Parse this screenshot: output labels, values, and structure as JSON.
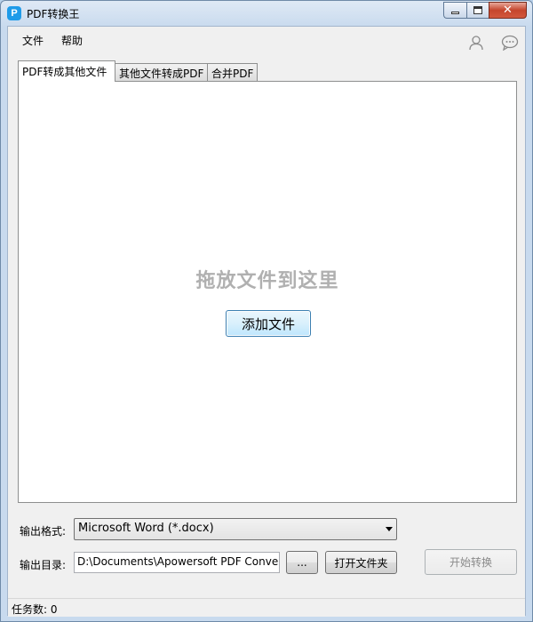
{
  "window": {
    "title": "PDF转换王",
    "icon_letter": "P",
    "close_glyph": "✕"
  },
  "menu": {
    "file": "文件",
    "help": "帮助"
  },
  "tabs": [
    {
      "label": "PDF转成其他文件",
      "active": true
    },
    {
      "label": "其他文件转成PDF",
      "active": false
    },
    {
      "label": "合并PDF",
      "active": false
    }
  ],
  "panel": {
    "drop_hint": "拖放文件到这里",
    "add_file_label": "添加文件"
  },
  "output": {
    "format_label": "输出格式:",
    "format_value": "Microsoft Word (*.docx)",
    "dir_label": "输出目录:",
    "dir_value": "D:\\Documents\\Apowersoft PDF Conver",
    "browse_label": "...",
    "open_folder_label": "打开文件夹",
    "start_label": "开始转换"
  },
  "status": {
    "task_count": "任务数: 0"
  },
  "colors": {
    "accent": "#1e9be9",
    "drop_hint": "#b0b0b0"
  }
}
